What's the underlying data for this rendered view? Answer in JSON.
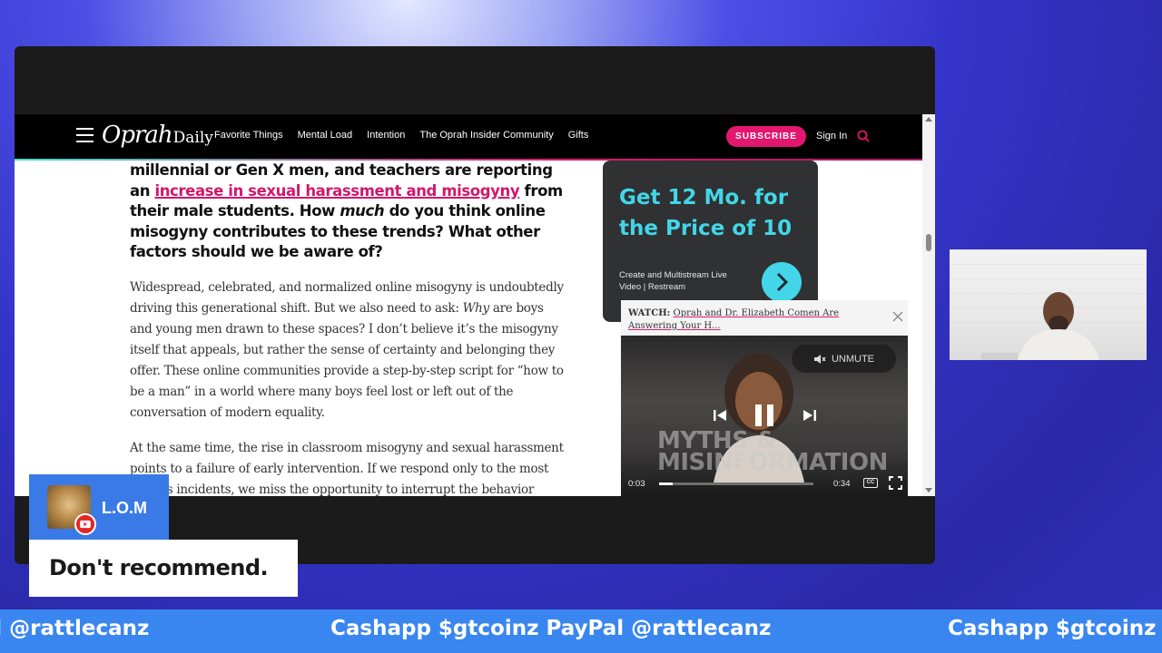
{
  "site": {
    "logo_script": "Oprah",
    "logo_word": "Daily",
    "nav_links": [
      "Favorite Things",
      "Mental Load",
      "Intention",
      "The Oprah Insider Community",
      "Gifts"
    ],
    "subscribe_label": "SUBSCRIBE",
    "signin_label": "Sign In",
    "accent_color": "#e3176f"
  },
  "article": {
    "question_lead": "millennial or Gen X men, and teachers are reporting an ",
    "question_link": "increase in sexual harassment and misogyny",
    "question_mid": " from their male students. How ",
    "question_em": "much",
    "question_tail": " do you think online misogyny contributes to these trends? What other factors should we be aware of?",
    "para1_a": "Widespread, celebrated, and normalized online misogyny is undoubtedly driving this generational shift. But we also need to ask: ",
    "para1_em": "Why",
    "para1_b": " are boys and young men drawn to these spaces? I don’t believe it’s the misogyny itself that appeals, but rather the sense of certainty and belonging they offer. These online communities provide a step-by-step script for “how to be a man” in a world where many boys feel lost or left out of the conversation of modern equality.",
    "para2": "At the same time, the rise in classroom misogyny and sexual harassment points to a failure of early intervention. If we respond only to the most serious incidents, we miss the opportunity to interrupt the behavior"
  },
  "ad": {
    "headline": "Get 12 Mo. for the Price of 10",
    "subtext": "Create and Multistream Live Video | Restream",
    "color": "#42d6e8"
  },
  "video": {
    "watch_label": "WATCH:",
    "caption": "Oprah and Dr. Elizabeth Comen Are Answering Your H...",
    "overlay_text": "MYTHS & MISINFORMATION",
    "unmute_label": "UNMUTE",
    "time_current": "0:03",
    "time_total": "0:34",
    "progress": 0.09,
    "cc_label": "CC"
  },
  "stream": {
    "badge_name": "L.O.M",
    "chat_message": "Don't recommend.",
    "ticker_segments": [
      {
        "text": "Cashapp $gtcoinz PayPal @rattlecanz"
      },
      {
        "text": "Cashapp $gtcoinz PayPal @rattlecanz"
      },
      {
        "text": "Cashapp $gtcoinz PayPal @rattlecanz"
      }
    ]
  }
}
